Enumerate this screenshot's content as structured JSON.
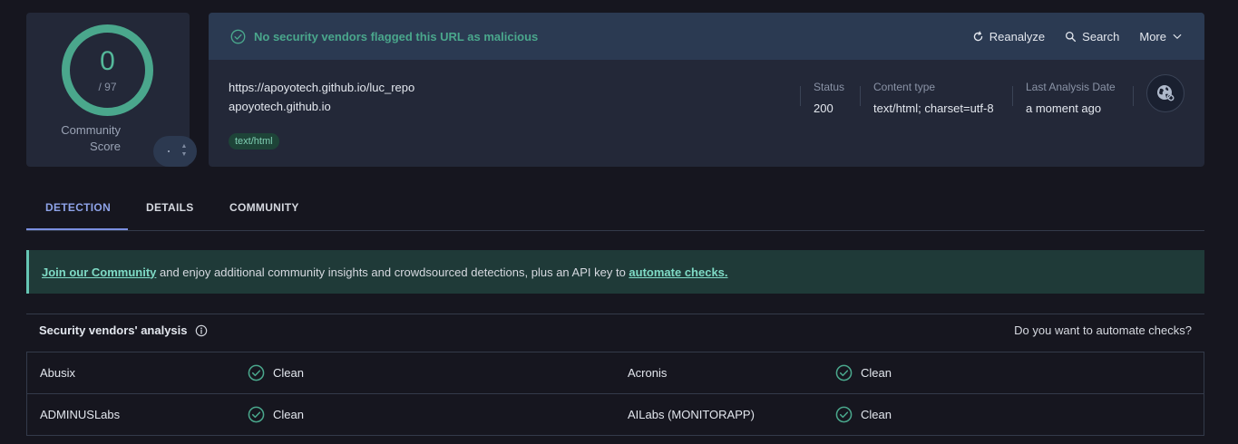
{
  "score": {
    "value": "0",
    "total": "/ 97",
    "community_label_line1": "Community",
    "community_label_line2": "Score"
  },
  "header": {
    "flag_text": "No security vendors flagged this URL as malicious",
    "reanalyze_label": "Reanalyze",
    "search_label": "Search",
    "more_label": "More"
  },
  "url_info": {
    "url": "https://apoyotech.github.io/luc_repo",
    "domain": "apoyotech.github.io",
    "tag": "text/html",
    "status_label": "Status",
    "status_value": "200",
    "content_type_label": "Content type",
    "content_type_value": "text/html; charset=utf-8",
    "last_analysis_label": "Last Analysis Date",
    "last_analysis_value": "a moment ago"
  },
  "tabs": [
    {
      "label": "DETECTION",
      "active": true
    },
    {
      "label": "DETAILS",
      "active": false
    },
    {
      "label": "COMMUNITY",
      "active": false
    }
  ],
  "banner": {
    "join_link": "Join our Community",
    "middle_text": " and enjoy additional community insights and crowdsourced detections, plus an API key to ",
    "automate_link": "automate checks."
  },
  "vendors": {
    "title": "Security vendors' analysis",
    "automate_question": "Do you want to automate checks?",
    "rows": [
      {
        "left_name": "Abusix",
        "left_status": "Clean",
        "right_name": "Acronis",
        "right_status": "Clean"
      },
      {
        "left_name": "ADMINUSLabs",
        "left_status": "Clean",
        "right_name": "AILabs (MONITORAPP)",
        "right_status": "Clean"
      }
    ]
  },
  "colors": {
    "accent_green": "#4aa78c",
    "tab_active": "#8ea3e8",
    "banner_link": "#7fdbc6"
  },
  "icons": [
    "check-circle-icon",
    "refresh-icon",
    "search-icon",
    "chevron-down-icon",
    "globe-icon",
    "info-icon"
  ]
}
